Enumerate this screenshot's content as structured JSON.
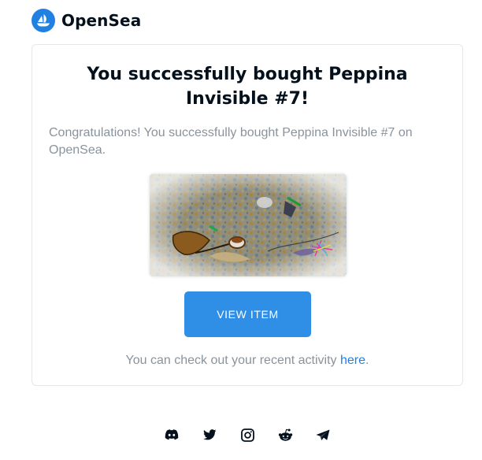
{
  "brand": {
    "name": "OpenSea",
    "color": "#2081e2"
  },
  "card": {
    "title": "You successfully bought Peppina Invisible #7!",
    "message": "Congratulations! You successfully bought Peppina Invisible #7 on OpenSea.",
    "image_icon": "nft-artwork",
    "button_label": "VIEW ITEM",
    "button_color": "#2f8ee5",
    "activity_prefix": "You can check out your recent activity ",
    "activity_link": "here",
    "activity_suffix": "."
  },
  "footer": {
    "socials": [
      {
        "icon": "discord-icon"
      },
      {
        "icon": "twitter-icon"
      },
      {
        "icon": "instagram-icon"
      },
      {
        "icon": "reddit-icon"
      },
      {
        "icon": "telegram-icon"
      }
    ]
  }
}
